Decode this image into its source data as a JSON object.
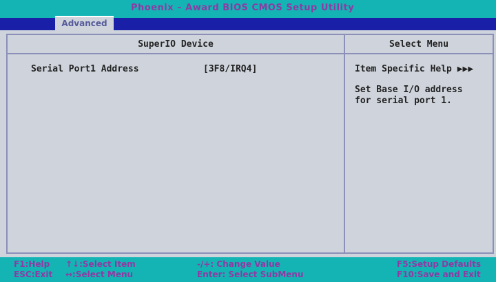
{
  "window": {
    "title": "Phoenix – Award BIOS CMOS Setup Utility"
  },
  "menu": {
    "active_tab": "Advanced"
  },
  "main": {
    "header": "SuperIO Device",
    "settings": [
      {
        "label": "Serial Port1 Address",
        "value": "[3F8/IRQ4]"
      }
    ]
  },
  "help": {
    "header": "Select Menu",
    "title": "Item Specific Help ▶▶▶",
    "text": "Set Base I/O address\nfor serial port 1."
  },
  "footer": {
    "col1": [
      "F1:Help",
      "ESC:Exit"
    ],
    "col2": [
      "↑↓:Select Item",
      "↔:Select Menu"
    ],
    "col3": [
      "-/+: Change Value",
      "Enter: Select SubMenu"
    ],
    "col4": [
      "F5:Setup Defaults",
      "F10:Save and Exit"
    ]
  },
  "colors": {
    "top_bar": "#14b4b4",
    "menu_row": "#1a1fa8",
    "panel_bg": "#cfd4dc",
    "title_text": "#8f3aa4"
  }
}
